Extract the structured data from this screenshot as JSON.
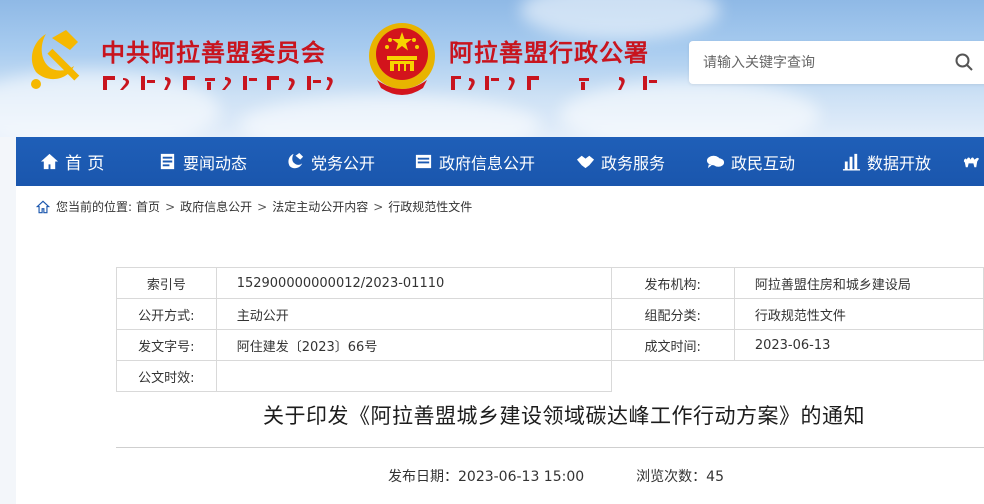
{
  "header": {
    "party_title": "中共阿拉善盟委员会",
    "gov_title": "阿拉善盟行政公署",
    "search_placeholder": "请输入关键字查询"
  },
  "nav": [
    {
      "label": "首 页",
      "icon": "home-icon"
    },
    {
      "label": "要闻动态",
      "icon": "document-list-icon"
    },
    {
      "label": "党务公开",
      "icon": "party-flag-icon"
    },
    {
      "label": "政府信息公开",
      "icon": "info-folder-icon"
    },
    {
      "label": "政务服务",
      "icon": "handshake-icon"
    },
    {
      "label": "政民互动",
      "icon": "chat-bubbles-icon"
    },
    {
      "label": "数据开放",
      "icon": "bar-chart-icon"
    },
    {
      "label": "",
      "icon": "camel-icon"
    }
  ],
  "breadcrumb": {
    "prefix": "您当前的位置:",
    "items": [
      "首页",
      "政府信息公开",
      "法定主动公开内容",
      "行政规范性文件"
    ]
  },
  "meta": {
    "rows": [
      {
        "label": "索引号",
        "value": "152900000000012/2023-01110",
        "label2": "发布机构:",
        "value2": "阿拉善盟住房和城乡建设局"
      },
      {
        "label": "公开方式:",
        "value": "主动公开",
        "label2": "组配分类:",
        "value2": "行政规范性文件"
      },
      {
        "label": "发文字号:",
        "value": "阿住建发〔2023〕66号",
        "label2": "成文时间:",
        "value2": "2023-06-13"
      },
      {
        "label": "公文时效:",
        "value": "",
        "label2": "",
        "value2": ""
      }
    ]
  },
  "article": {
    "title": "关于印发《阿拉善盟城乡建设领域碳达峰工作行动方案》的通知",
    "publish_date": "发布日期：2023-06-13 15:00",
    "views": "浏览次数：45"
  },
  "colors": {
    "nav_blue": "#1a56ad",
    "title_red": "#c8141e"
  }
}
